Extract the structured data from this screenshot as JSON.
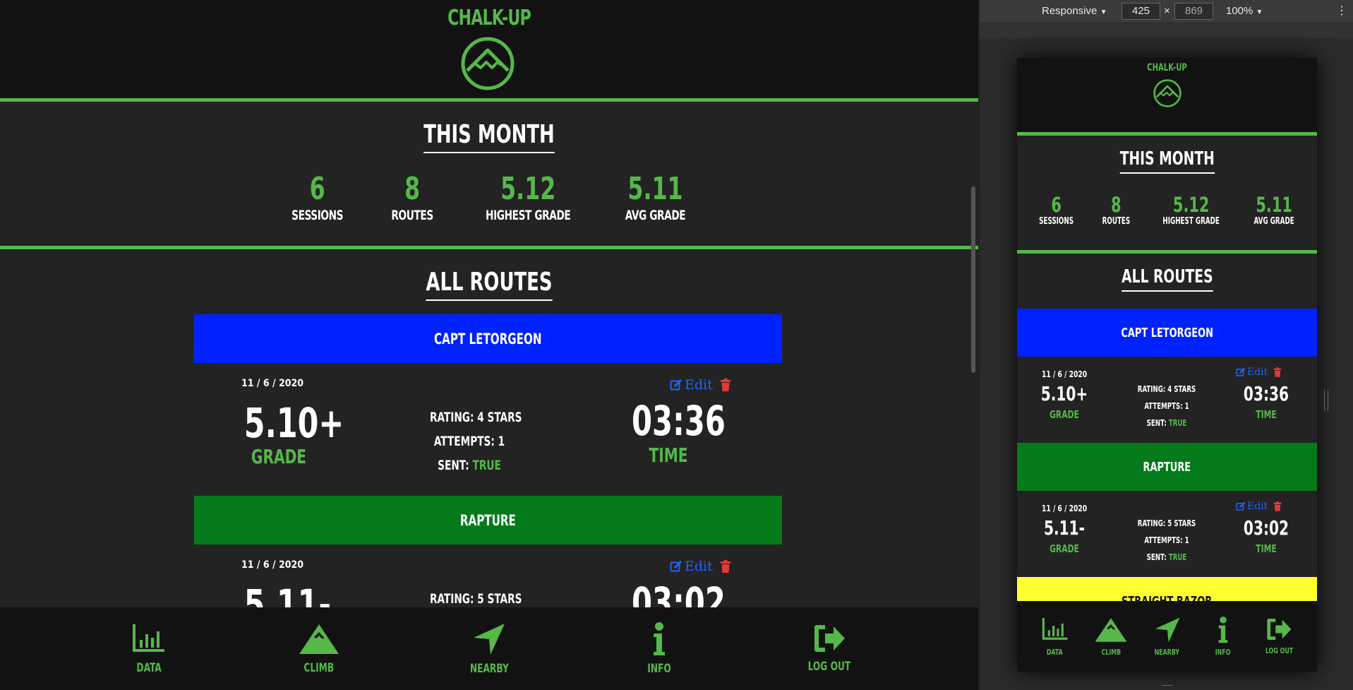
{
  "app": {
    "name": "CHALK-UP",
    "colors": {
      "accent": "#55b849",
      "background": "#232323",
      "header": "#121212",
      "edit_blue": "#1a66ff",
      "delete_red": "#e53935"
    }
  },
  "this_month": {
    "title": "THIS MONTH",
    "stats": [
      {
        "value": "6",
        "label": "SESSIONS"
      },
      {
        "value": "8",
        "label": "ROUTES"
      },
      {
        "value": "5.12",
        "label": "HIGHEST GRADE"
      },
      {
        "value": "5.11",
        "label": "AVG GRADE"
      }
    ]
  },
  "all_routes": {
    "title": "ALL ROUTES",
    "routes": [
      {
        "name": "CAPT LETORGEON",
        "color": "#0022ff",
        "date": "11 / 6 / 2020",
        "grade": "5.10+",
        "grade_label": "GRADE",
        "rating": "RATING: 4 STARS",
        "attempts": "ATTEMPTS: 1",
        "sent_label": "SENT:",
        "sent_value": "TRUE",
        "time": "03:36",
        "time_label": "TIME",
        "edit_label": "Edit"
      },
      {
        "name": "RAPTURE",
        "color": "#057a1b",
        "date": "11 / 6 / 2020",
        "grade": "5.11-",
        "grade_label": "GRADE",
        "rating": "RATING: 5 STARS",
        "attempts": "ATTEMPTS: 1",
        "sent_label": "SENT:",
        "sent_value": "TRUE",
        "time": "03:02",
        "time_label": "TIME",
        "edit_label": "Edit"
      },
      {
        "name": "STRAIGHT RAZOR",
        "color": "#ffff33"
      }
    ]
  },
  "nav": [
    {
      "label": "DATA",
      "icon": "bar-chart-icon"
    },
    {
      "label": "CLIMB",
      "icon": "mountain-icon"
    },
    {
      "label": "NEARBY",
      "icon": "location-arrow-icon"
    },
    {
      "label": "INFO",
      "icon": "info-icon"
    },
    {
      "label": "LOG OUT",
      "icon": "sign-out-icon"
    }
  ],
  "devtools": {
    "device": "Responsive",
    "width": "425",
    "times": "×",
    "height": "869",
    "zoom": "100%"
  }
}
